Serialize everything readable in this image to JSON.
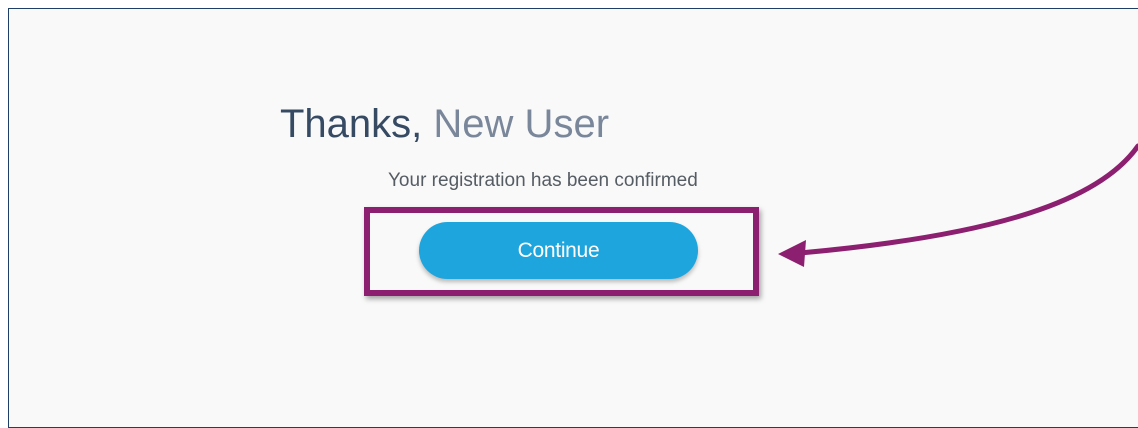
{
  "heading": {
    "thanks": "Thanks,",
    "user_name": "New User"
  },
  "message": "Your registration has been confirmed",
  "continue_button": {
    "label": "Continue"
  },
  "annotation": {
    "color": "#8c1f6f"
  }
}
